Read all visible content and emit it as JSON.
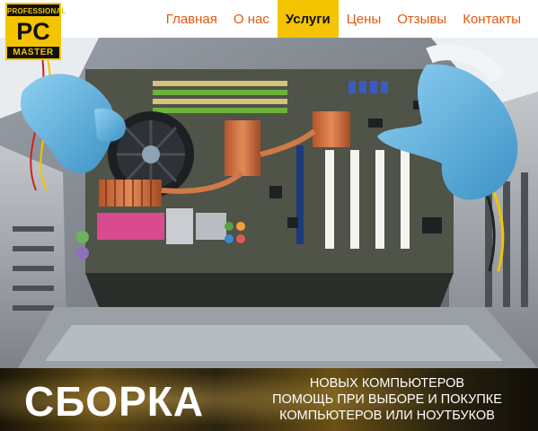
{
  "logo": {
    "top": "PROFESSIONAL",
    "middle": "PC",
    "bottom": "MASTER"
  },
  "nav": {
    "items": [
      {
        "label": "Главная",
        "active": false
      },
      {
        "label": "О нас",
        "active": false
      },
      {
        "label": "Услуги",
        "active": true
      },
      {
        "label": "Цены",
        "active": false
      },
      {
        "label": "Отзывы",
        "active": false
      },
      {
        "label": "Контакты",
        "active": false
      }
    ]
  },
  "colors": {
    "accent": "#f5c400",
    "nav_text": "#e2570e",
    "glove": "#5fb0dc",
    "pcb": "#4f5348"
  },
  "banner": {
    "title": "СБОРКА",
    "lines": [
      "НОВЫХ КОМПЬЮТЕРОВ",
      "ПОМОЩЬ ПРИ ВЫБОРЕ И ПОКУПКЕ",
      "КОМПЬЮТЕРОВ  ИЛИ  НОУТБУКОВ"
    ]
  }
}
